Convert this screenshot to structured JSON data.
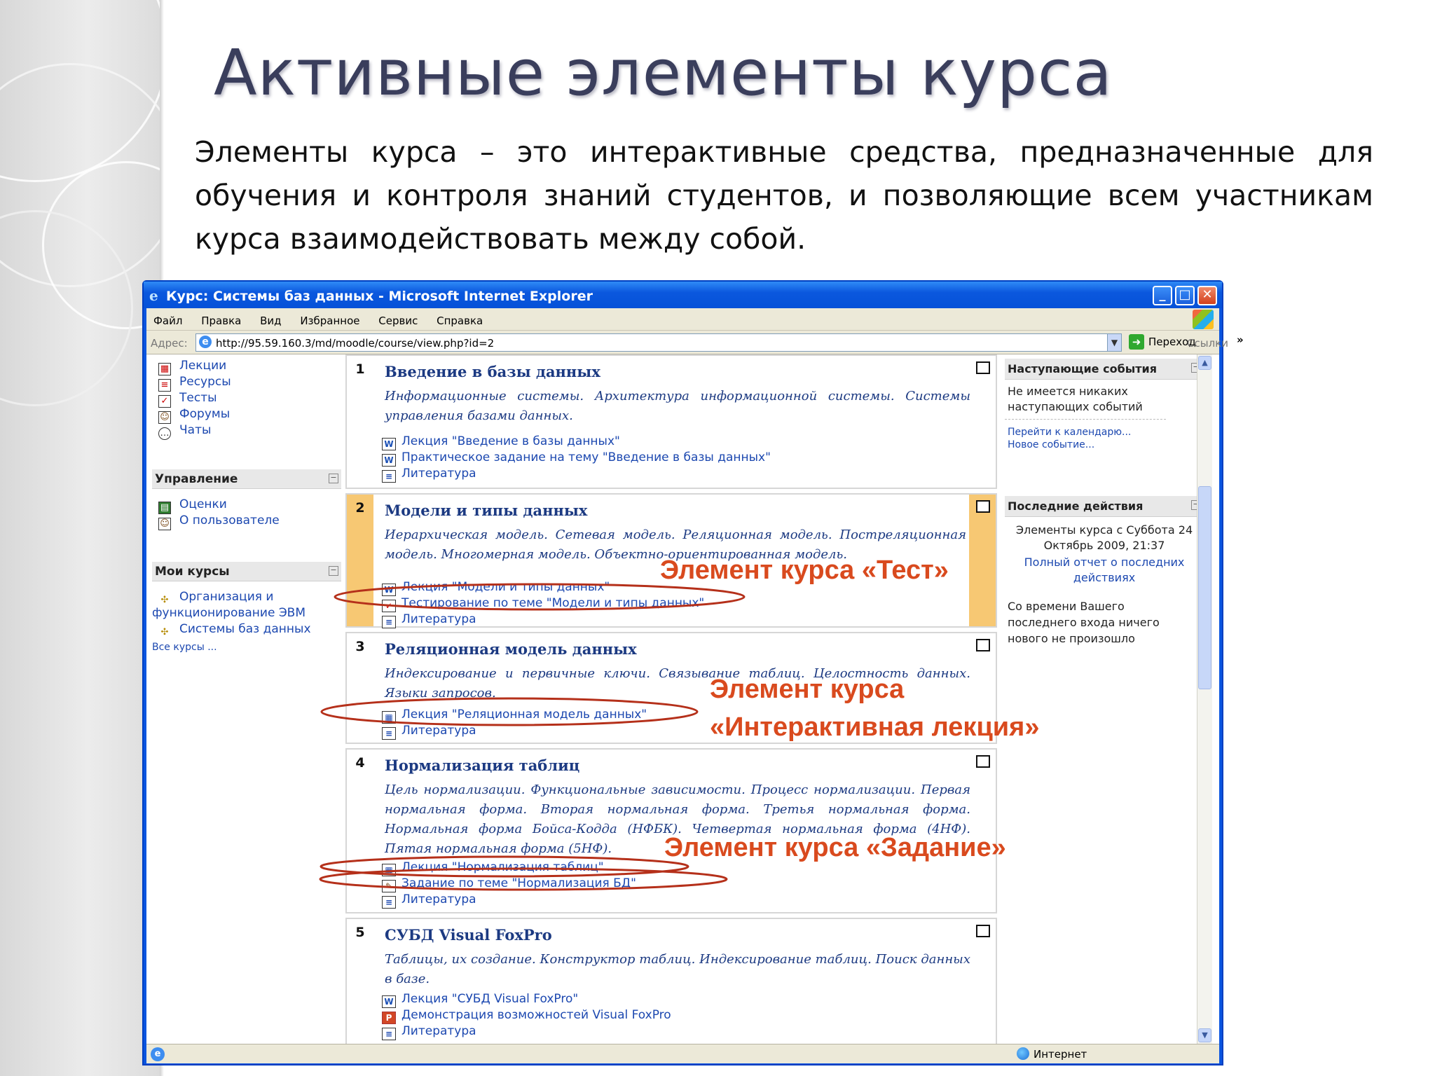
{
  "slide": {
    "title": "Активные элементы курса",
    "intro": "Элементы курса – это интерактивные средства, предназначенные для обучения и контроля знаний студентов, и позволяющие всем участникам курса взаимодействовать между собой."
  },
  "browser": {
    "window_title": "Курс: Системы баз данных - Microsoft Internet Explorer",
    "menu": [
      "Файл",
      "Правка",
      "Вид",
      "Избранное",
      "Сервис",
      "Справка"
    ],
    "address_label": "Адрес:",
    "address_url": "http://95.59.160.3/md/moodle/course/view.php?id=2",
    "go_label": "Переход",
    "links_label": "Ссылки",
    "links_more": "»",
    "status_zone": "Интернет"
  },
  "left_column": {
    "activities": [
      {
        "label": "Лекции",
        "icon": "lesson-icon"
      },
      {
        "label": "Ресурсы",
        "icon": "resource-icon"
      },
      {
        "label": "Тесты",
        "icon": "quiz-icon"
      },
      {
        "label": "Форумы",
        "icon": "forum-icon"
      },
      {
        "label": "Чаты",
        "icon": "chat-icon"
      }
    ],
    "admin_title": "Управление",
    "admin_items": [
      {
        "label": "Оценки",
        "icon": "grades-icon"
      },
      {
        "label": "О пользователе",
        "icon": "user-icon"
      }
    ],
    "mycourses_title": "Мои курсы",
    "mycourses_items": [
      "Организация и",
      "функционирование ЭВМ",
      "Системы баз данных"
    ],
    "all_courses": "Все курсы ..."
  },
  "sections": [
    {
      "num": "1",
      "title": "Введение в базы данных",
      "desc": "Информационные системы. Архитектура информационной системы. Системы управления базами данных.",
      "resources": [
        {
          "label": "Лекция \"Введение в базы данных\"",
          "icon": "word-icon"
        },
        {
          "label": "Практическое задание на тему \"Введение в базы данных\"",
          "icon": "word-icon"
        },
        {
          "label": "Литература",
          "icon": "document-icon"
        }
      ]
    },
    {
      "num": "2",
      "title": "Модели и типы данных",
      "desc": "Иерархическая модель. Сетевая модель. Реляционная модель. Постреляционная модель. Многомерная модель. Объектно-ориентированная модель.",
      "resources": [
        {
          "label": "Лекция \"Модели и типы данных\"",
          "icon": "word-icon"
        },
        {
          "label": "Тестирование по теме \"Модели и типы данных\"",
          "icon": "quiz-icon"
        },
        {
          "label": "Литература",
          "icon": "document-icon"
        }
      ]
    },
    {
      "num": "3",
      "title": "Реляционная модель данных",
      "desc": "Индексирование и первичные ключи. Связывание таблиц. Целостность данных. Языки запросов.",
      "resources": [
        {
          "label": "Лекция \"Реляционная модель данных\"",
          "icon": "lesson-icon"
        },
        {
          "label": "Литература",
          "icon": "document-icon"
        }
      ]
    },
    {
      "num": "4",
      "title": "Нормализация таблиц",
      "desc": "Цель нормализации. Функциональные зависимости. Процесс нормализации. Первая нормальная форма. Вторая нормальная форма. Третья нормальная форма. Нормальная форма Бойса-Кодда (НФБК). Четвертая нормальная форма (4НФ). Пятая нормальная форма (5НФ).",
      "resources": [
        {
          "label": "Лекция \"Нормализация таблиц\"",
          "icon": "lesson-icon"
        },
        {
          "label": "Задание по теме \"Нормализация БД\"",
          "icon": "assignment-icon"
        },
        {
          "label": "Литература",
          "icon": "document-icon"
        }
      ]
    },
    {
      "num": "5",
      "title": "СУБД Visual FoxPro",
      "desc": "Таблицы, их создание. Конструктор таблиц. Индексирование таблиц. Поиск данных в базе.",
      "resources": [
        {
          "label": "Лекция \"СУБД Visual FoxPro\"",
          "icon": "word-icon"
        },
        {
          "label": "Демонстрация возможностей Visual FoxPro",
          "icon": "powerpoint-icon"
        },
        {
          "label": "Литература",
          "icon": "document-icon"
        }
      ]
    }
  ],
  "right_column": {
    "upcoming_title": "Наступающие события",
    "upcoming_text": "Не имеется никаких наступающих событий",
    "calendar_link": "Перейти к календарю...",
    "new_event_link": "Новое событие...",
    "recent_title": "Последние действия",
    "recent_since": "Элементы курса с Суббота 24 Октябрь 2009, 21:37",
    "full_report_link": "Полный отчет о последних действиях",
    "nothing_new": "Со времени Вашего последнего входа ничего нового не произошло"
  },
  "callouts": {
    "test": "Элемент курса «Тест»",
    "lecture_line1": "Элемент курса",
    "lecture_line2": "«Интерактивная лекция»",
    "assignment": "Элемент курса «Задание»"
  },
  "colors": {
    "title": "#3a3e5c",
    "callout": "#d94a1e",
    "ellipse": "#b5301a",
    "link": "#1c48b0",
    "section_title": "#1c3a82",
    "current_section": "#f7c873",
    "window_frame": "#0a55e0"
  }
}
